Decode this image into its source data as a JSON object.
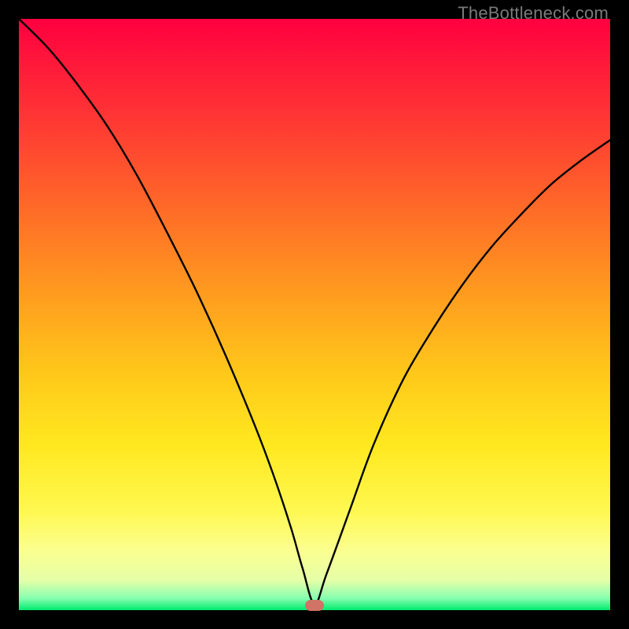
{
  "watermark": "TheBottleneck.com",
  "marker": {
    "x_frac": 0.5,
    "y_frac": 0.992
  },
  "chart_data": {
    "type": "line",
    "title": "",
    "xlabel": "",
    "ylabel": "",
    "xlim": [
      0,
      1
    ],
    "ylim": [
      0,
      1
    ],
    "grid": false,
    "legend": false,
    "series": [
      {
        "name": "bottleneck-curve",
        "x": [
          0.0,
          0.05,
          0.1,
          0.15,
          0.2,
          0.25,
          0.3,
          0.35,
          0.4,
          0.43,
          0.46,
          0.48,
          0.5,
          0.52,
          0.56,
          0.6,
          0.65,
          0.7,
          0.75,
          0.8,
          0.85,
          0.9,
          0.95,
          1.0
        ],
        "y": [
          1.0,
          0.95,
          0.888,
          0.818,
          0.735,
          0.64,
          0.54,
          0.43,
          0.31,
          0.23,
          0.14,
          0.07,
          0.01,
          0.06,
          0.17,
          0.28,
          0.39,
          0.475,
          0.55,
          0.615,
          0.67,
          0.72,
          0.76,
          0.795
        ]
      }
    ],
    "annotations": []
  }
}
